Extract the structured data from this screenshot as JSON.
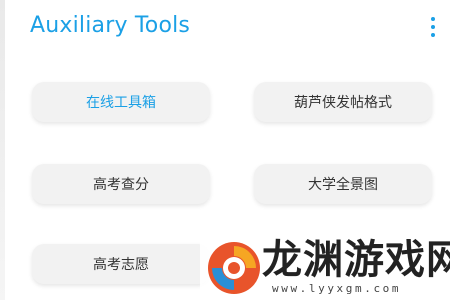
{
  "app_bar": {
    "title": "Auxiliary Tools",
    "menu_icon": "more-vertical-icon",
    "accent_color": "#1ba0e6"
  },
  "tools": {
    "items": [
      {
        "label": "在线工具箱",
        "active": true
      },
      {
        "label": "葫芦侠发帖格式",
        "active": false
      },
      {
        "label": "高考查分",
        "active": false
      },
      {
        "label": "大学全景图",
        "active": false
      },
      {
        "label": "高考志愿",
        "active": false
      }
    ]
  },
  "watermark": {
    "text": "龙渊游戏网",
    "url": "www.lyyxgm.com"
  }
}
